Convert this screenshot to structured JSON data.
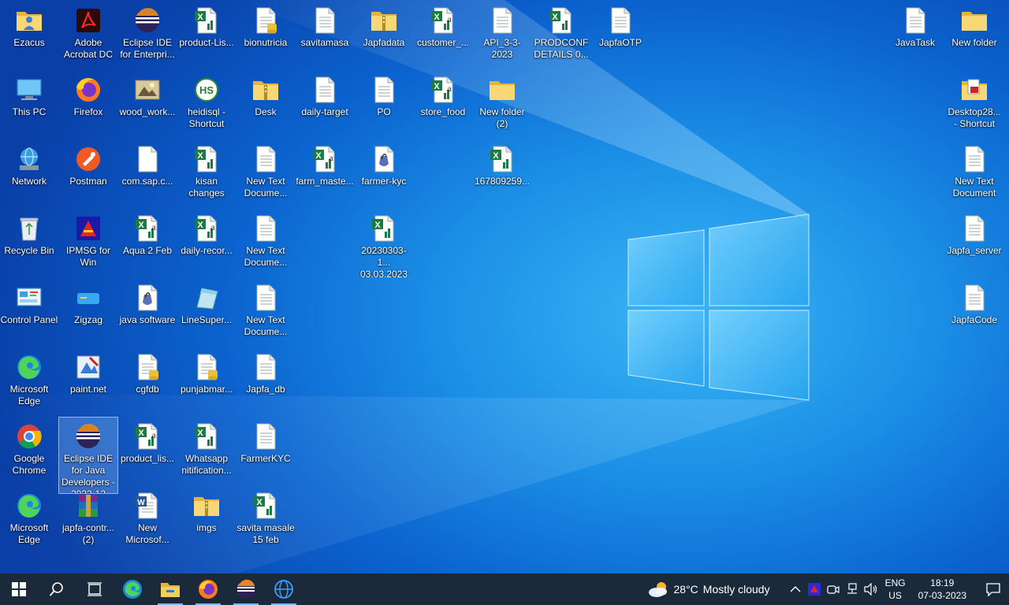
{
  "desktop": {
    "icons": [
      {
        "label": "Ezacus",
        "type": "user-folder-icon",
        "col": 0,
        "row": 0
      },
      {
        "label": "This PC",
        "type": "this-pc-icon",
        "col": 0,
        "row": 1
      },
      {
        "label": "Network",
        "type": "network-icon",
        "col": 0,
        "row": 2
      },
      {
        "label": "Recycle Bin",
        "type": "recycle-bin-icon",
        "col": 0,
        "row": 3
      },
      {
        "label": "Control Panel",
        "type": "control-panel-icon",
        "col": 0,
        "row": 4
      },
      {
        "label": "Microsoft Edge",
        "type": "edge-icon",
        "col": 0,
        "row": 5
      },
      {
        "label": "Google Chrome",
        "type": "chrome-icon",
        "col": 0,
        "row": 6
      },
      {
        "label": "Microsoft Edge",
        "type": "edge-icon",
        "col": 0,
        "row": 7
      },
      {
        "label": "Adobe Acrobat DC",
        "type": "acrobat-icon",
        "col": 1,
        "row": 0
      },
      {
        "label": "Firefox",
        "type": "firefox-icon",
        "col": 1,
        "row": 1
      },
      {
        "label": "Postman",
        "type": "postman-icon",
        "col": 1,
        "row": 2
      },
      {
        "label": "IPMSG for Win",
        "type": "ipmsg-icon",
        "col": 1,
        "row": 3
      },
      {
        "label": "Zigzag",
        "type": "zigzag-icon",
        "col": 1,
        "row": 4
      },
      {
        "label": "paint.net",
        "type": "paintnet-icon",
        "col": 1,
        "row": 5
      },
      {
        "label": "Eclipse IDE for Java Developers - 2022-12",
        "type": "eclipse-icon",
        "col": 1,
        "row": 6,
        "selected": true
      },
      {
        "label": "japfa-contr... (2)",
        "type": "winrar-icon",
        "col": 1,
        "row": 7
      },
      {
        "label": "Eclipse IDE for Enterpri...",
        "type": "eclipse-icon",
        "col": 2,
        "row": 0
      },
      {
        "label": "wood_work...",
        "type": "image-icon",
        "col": 2,
        "row": 1
      },
      {
        "label": "com.sap.c...",
        "type": "blank-file-icon",
        "col": 2,
        "row": 2
      },
      {
        "label": "Aqua 2 Feb",
        "type": "excel-csv-icon",
        "col": 2,
        "row": 3
      },
      {
        "label": "java software",
        "type": "jar-icon",
        "col": 2,
        "row": 4
      },
      {
        "label": "cgfdb",
        "type": "db-file-icon",
        "col": 2,
        "row": 5
      },
      {
        "label": "product_lis...",
        "type": "excel-csv-icon",
        "col": 2,
        "row": 6
      },
      {
        "label": "New Microsof...",
        "type": "word-icon",
        "col": 2,
        "row": 7
      },
      {
        "label": "product-Lis...",
        "type": "excel-icon",
        "col": 3,
        "row": 0
      },
      {
        "label": "heidisql - Shortcut",
        "type": "heidisql-icon",
        "col": 3,
        "row": 1
      },
      {
        "label": "kisan changes",
        "type": "excel-icon",
        "col": 3,
        "row": 2
      },
      {
        "label": "daily-recor...",
        "type": "excel-csv-icon",
        "col": 3,
        "row": 3
      },
      {
        "label": "LineSuper...",
        "type": "linesuper-icon",
        "col": 3,
        "row": 4
      },
      {
        "label": "punjabmar...",
        "type": "db-file-icon",
        "col": 3,
        "row": 5
      },
      {
        "label": "Whatsapp nitification...",
        "type": "excel-icon",
        "col": 3,
        "row": 6
      },
      {
        "label": "imgs",
        "type": "zip-folder-icon",
        "col": 3,
        "row": 7
      },
      {
        "label": "bionutricia",
        "type": "db-file-icon",
        "col": 4,
        "row": 0
      },
      {
        "label": "Desk",
        "type": "zip-folder-icon",
        "col": 4,
        "row": 1
      },
      {
        "label": "New Text Docume...",
        "type": "text-file-icon",
        "col": 4,
        "row": 2
      },
      {
        "label": "New Text Docume...",
        "type": "text-file-icon",
        "col": 4,
        "row": 3
      },
      {
        "label": "New Text Docume...",
        "type": "text-file-icon",
        "col": 4,
        "row": 4
      },
      {
        "label": "Japfa_db",
        "type": "text-file-icon",
        "col": 4,
        "row": 5
      },
      {
        "label": "FarmerKYC",
        "type": "text-file-icon",
        "col": 4,
        "row": 6
      },
      {
        "label": "savita masale 15 feb",
        "type": "excel-icon",
        "col": 4,
        "row": 7
      },
      {
        "label": "savitamasa",
        "type": "text-file-icon",
        "col": 5,
        "row": 0
      },
      {
        "label": "daily-target",
        "type": "text-file-icon",
        "col": 5,
        "row": 1
      },
      {
        "label": "farm_maste...",
        "type": "excel-csv-icon",
        "col": 5,
        "row": 2
      },
      {
        "label": "Japfadata",
        "type": "zip-folder-icon",
        "col": 6,
        "row": 0
      },
      {
        "label": "PO",
        "type": "text-file-icon",
        "col": 6,
        "row": 1
      },
      {
        "label": "farmer-kyc",
        "type": "jar-icon",
        "col": 6,
        "row": 2
      },
      {
        "label": "20230303-1... 03.03.2023",
        "type": "excel-icon",
        "col": 6,
        "row": 3
      },
      {
        "label": "customer_...",
        "type": "excel-csv-icon",
        "col": 7,
        "row": 0
      },
      {
        "label": "store_food",
        "type": "excel-csv-icon",
        "col": 7,
        "row": 1
      },
      {
        "label": "API_3-3-2023",
        "type": "text-file-icon",
        "col": 8,
        "row": 0
      },
      {
        "label": "New folder (2)",
        "type": "folder-icon",
        "col": 8,
        "row": 1
      },
      {
        "label": "167809259...",
        "type": "excel-icon",
        "col": 8,
        "row": 2
      },
      {
        "label": "PRODCONF DETAILS 0...",
        "type": "excel-icon",
        "col": 9,
        "row": 0
      },
      {
        "label": "JapfaOTP",
        "type": "text-file-icon",
        "col": 10,
        "row": 0
      },
      {
        "label": "JavaTask",
        "type": "text-file-icon",
        "col": 15,
        "row": 0
      },
      {
        "label": "New folder",
        "type": "folder-icon",
        "col": 16,
        "row": 0
      },
      {
        "label": "Desktop28... - Shortcut",
        "type": "pdf-folder-icon",
        "col": 16,
        "row": 1
      },
      {
        "label": "New Text Document",
        "type": "text-file-icon",
        "col": 16,
        "row": 2
      },
      {
        "label": "Japfa_server",
        "type": "text-file-icon",
        "col": 16,
        "row": 3
      },
      {
        "label": "JapfaCode",
        "type": "text-file-icon",
        "col": 16,
        "row": 4
      }
    ]
  },
  "taskbar": {
    "buttons": [
      {
        "name": "start-button",
        "icon": "windows-logo-icon"
      },
      {
        "name": "search-button",
        "icon": "search-icon"
      },
      {
        "name": "task-view-button",
        "icon": "task-view-icon"
      },
      {
        "name": "edge-taskbar-button",
        "icon": "edge-icon"
      },
      {
        "name": "file-explorer-taskbar-button",
        "icon": "folder-icon",
        "open": true
      },
      {
        "name": "firefox-taskbar-button",
        "icon": "firefox-icon",
        "open": true
      },
      {
        "name": "eclipse-taskbar-button",
        "icon": "eclipse-icon",
        "open": true
      },
      {
        "name": "network-app-taskbar-button",
        "icon": "globe-icon",
        "open": true
      }
    ],
    "weather": {
      "temp": "28°C",
      "condition": "Mostly cloudy"
    },
    "language": {
      "lang": "ENG",
      "region": "US"
    },
    "clock": {
      "time": "18:19",
      "date": "07-03-2023"
    }
  }
}
